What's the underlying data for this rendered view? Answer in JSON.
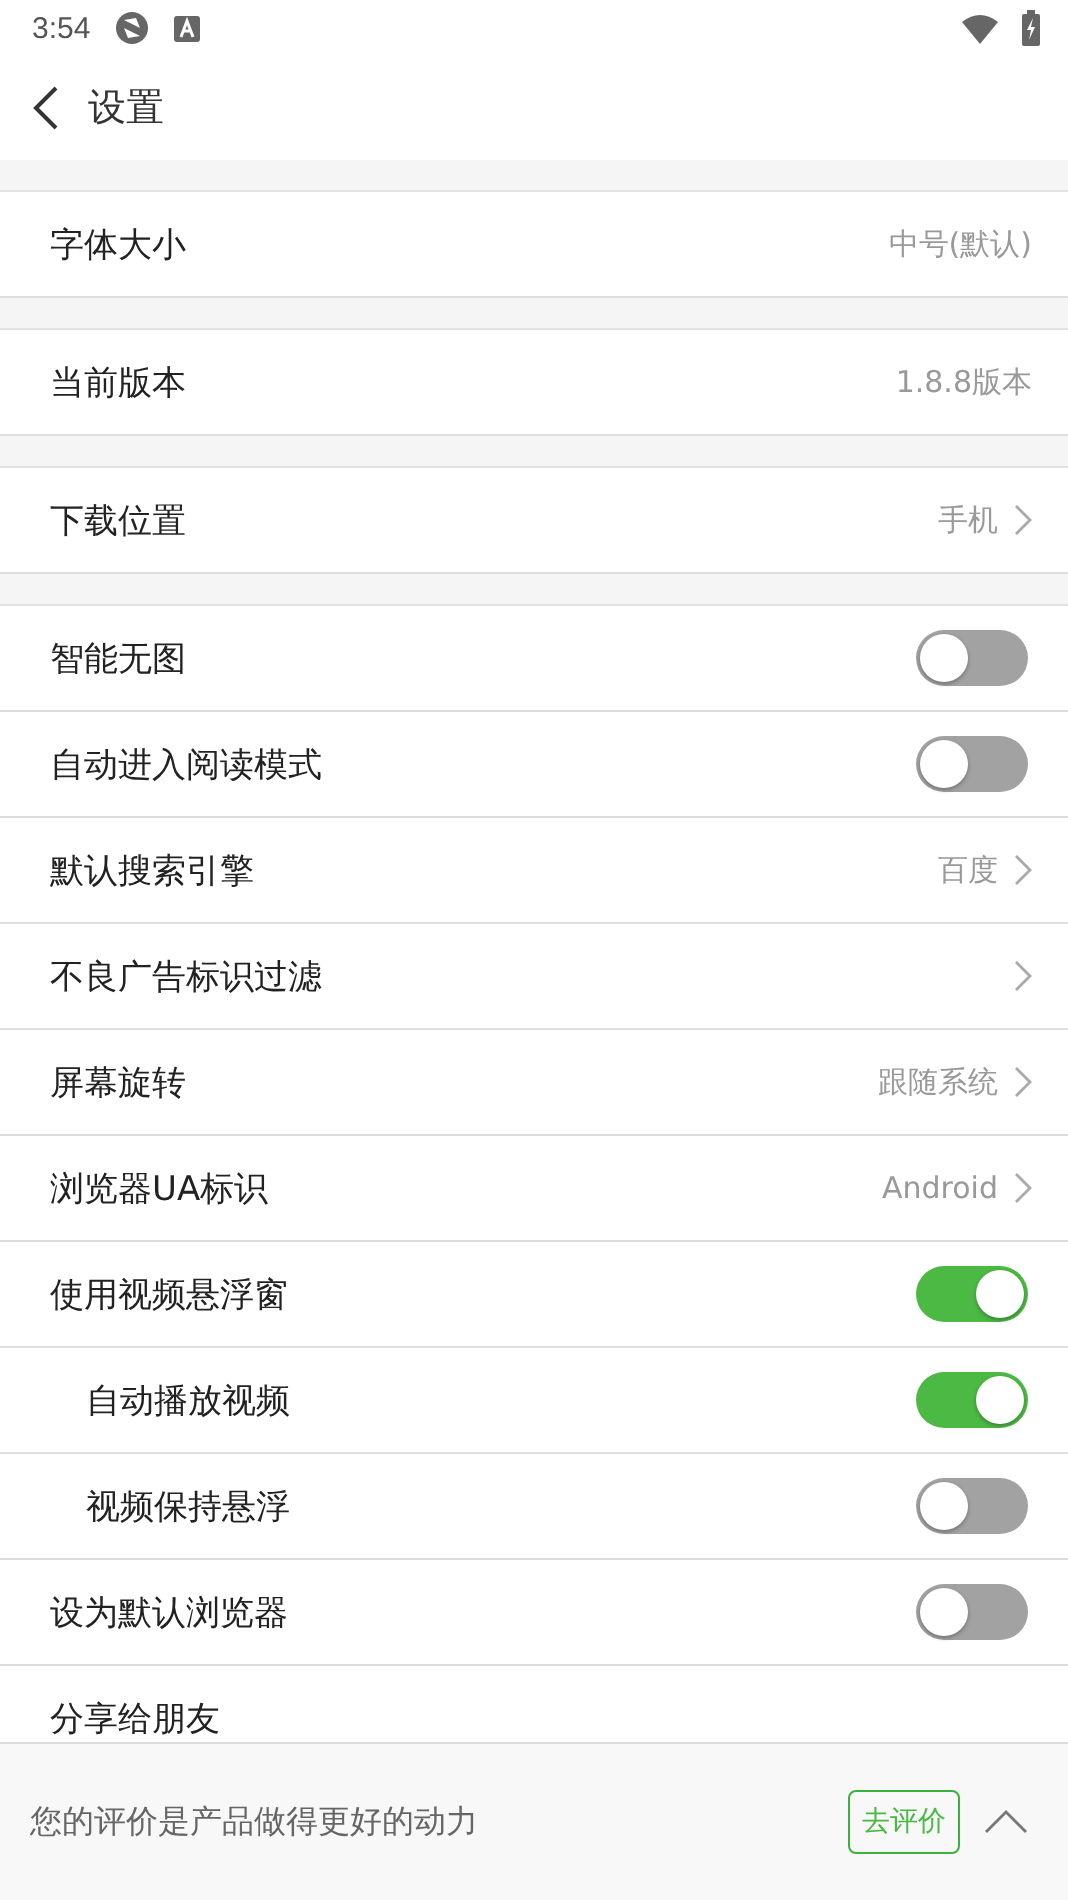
{
  "status_bar": {
    "time": "3:54"
  },
  "header": {
    "title": "设置"
  },
  "groups": [
    {
      "items": [
        {
          "kind": "value",
          "label": "字体大小",
          "value": "中号(默认)"
        }
      ]
    },
    {
      "items": [
        {
          "kind": "value",
          "label": "当前版本",
          "value": "1.8.8版本"
        }
      ]
    },
    {
      "items": [
        {
          "kind": "link",
          "label": "下载位置",
          "value": "手机"
        }
      ]
    },
    {
      "items": [
        {
          "kind": "toggle",
          "label": "智能无图",
          "on": false
        },
        {
          "kind": "toggle",
          "label": "自动进入阅读模式",
          "on": false
        },
        {
          "kind": "link",
          "label": "默认搜索引擎",
          "value": "百度"
        },
        {
          "kind": "link",
          "label": "不良广告标识过滤"
        },
        {
          "kind": "link",
          "label": "屏幕旋转",
          "value": "跟随系统"
        },
        {
          "kind": "link",
          "label": "浏览器UA标识",
          "value": "Android"
        },
        {
          "kind": "toggle",
          "label": "使用视频悬浮窗",
          "on": true,
          "children": [
            {
              "kind": "toggle",
              "label": "自动播放视频",
              "on": true
            },
            {
              "kind": "toggle",
              "label": "视频保持悬浮",
              "on": false
            }
          ]
        },
        {
          "kind": "toggle",
          "label": "设为默认浏览器",
          "on": false
        },
        {
          "kind": "value",
          "label": "分享给朋友"
        }
      ]
    }
  ],
  "rating_bar": {
    "message": "您的评价是产品做得更好的动力",
    "button": "去评价"
  }
}
